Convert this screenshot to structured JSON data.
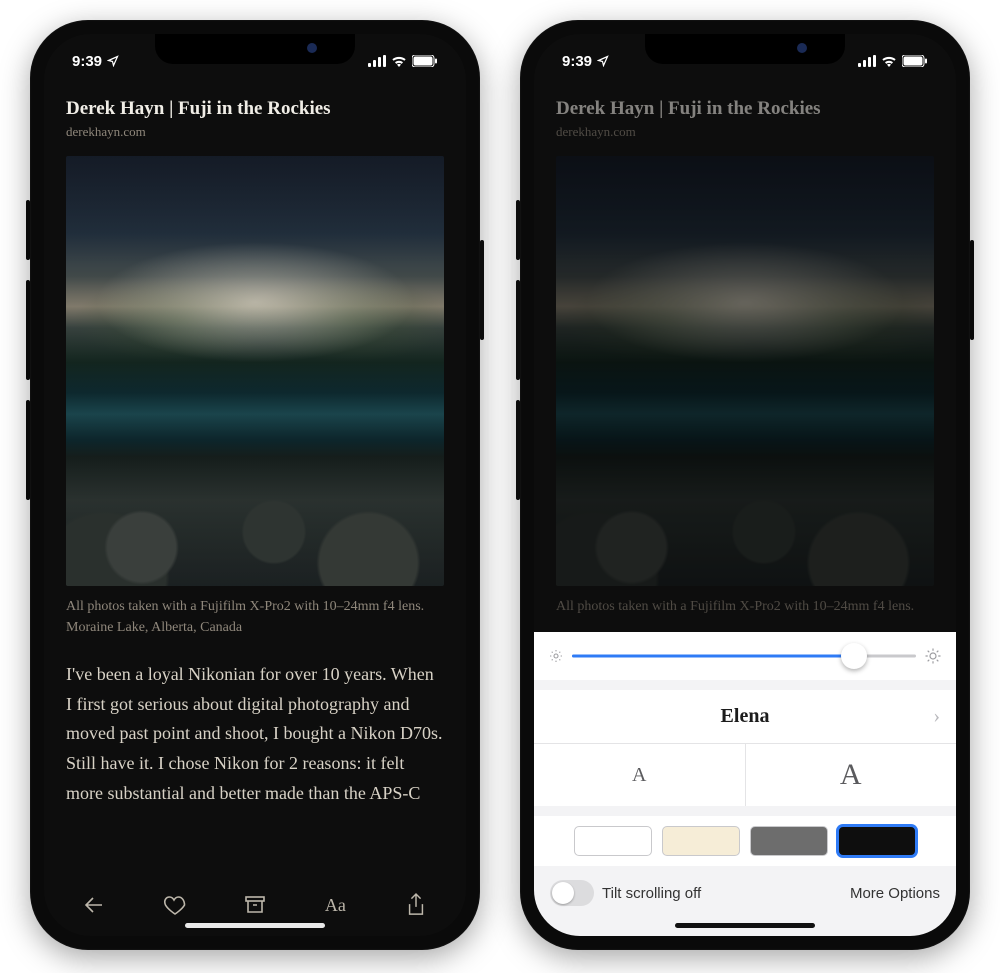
{
  "status": {
    "time": "9:39",
    "carrier_bars": 4,
    "wifi": true,
    "battery": 100
  },
  "article": {
    "title": "Derek Hayn | Fuji in the Rockies",
    "domain": "derekhayn.com",
    "caption": "All photos taken with a Fujifilm X-Pro2 with 10–24mm f4 lens. Moraine Lake, Alberta, Canada",
    "body_excerpt": "I've been a loyal Nikonian for over 10 years. When I first got serious about digital photography and moved past point and shoot, I bought a Nikon D70s. Still have it. I chose Nikon for 2 reasons: it felt more substantial and better made than the APS-C"
  },
  "toolbar": {
    "back": "back-arrow",
    "like": "heart",
    "archive": "archive-box",
    "text": "Aa",
    "share": "share"
  },
  "settings": {
    "brightness_pct": 82,
    "font_name": "Elena",
    "size_small": "A",
    "size_big": "A",
    "themes": [
      {
        "name": "white",
        "color": "#ffffff",
        "selected": false
      },
      {
        "name": "sepia",
        "color": "#f6edd7",
        "selected": false
      },
      {
        "name": "gray",
        "color": "#6d6d6d",
        "selected": false
      },
      {
        "name": "black",
        "color": "#0e0e0e",
        "selected": true
      }
    ],
    "tilt_toggle_label": "Tilt scrolling off",
    "tilt_on": false,
    "more_options": "More Options"
  }
}
